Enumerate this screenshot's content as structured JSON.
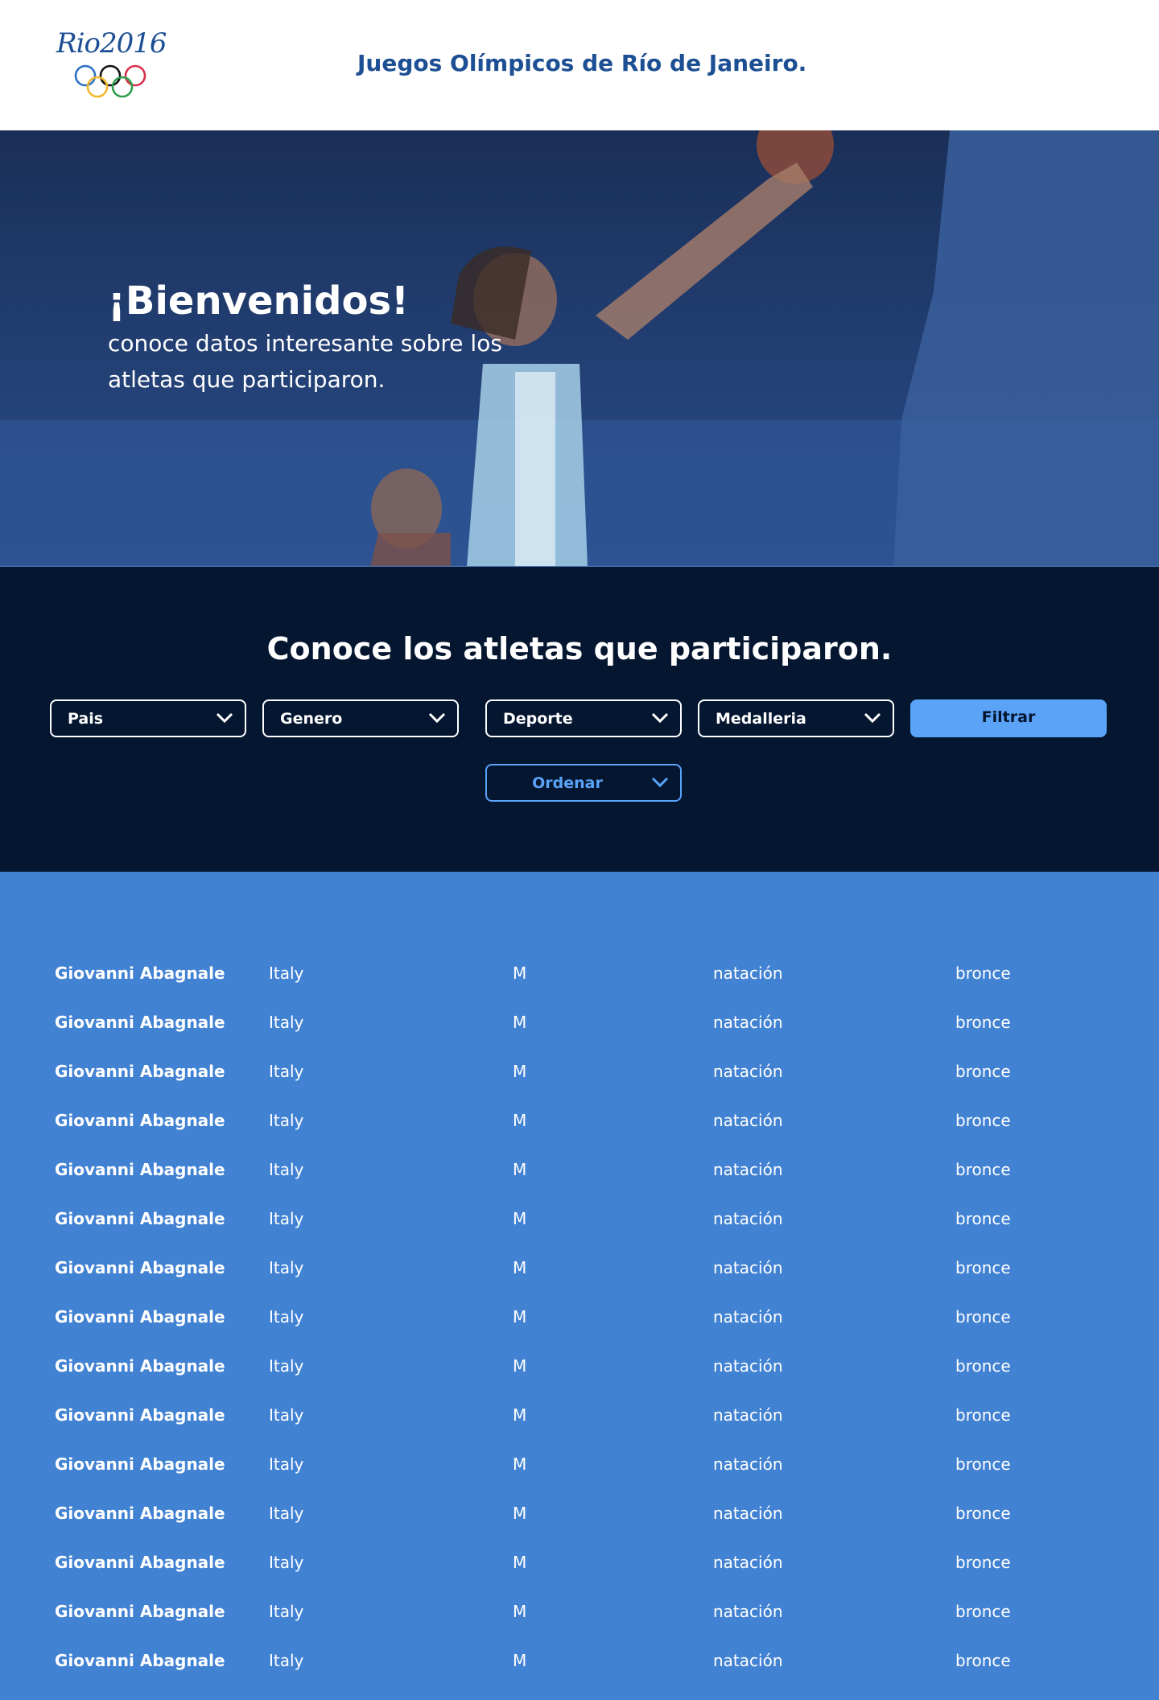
{
  "header": {
    "logo_text": "Rio2016",
    "title": "Juegos Olímpicos de Río de Janeiro."
  },
  "hero": {
    "title": "¡Bienvenidos!",
    "subtitle": "conoce datos interesante sobre los atletas que participaron."
  },
  "filters": {
    "title": "Conoce los atletas que participaron.",
    "country": "Pais",
    "gender": "Genero",
    "sport": "Deporte",
    "medals": "Medalleria",
    "filter_button": "Filtrar",
    "sort": "Ordenar"
  },
  "colors": {
    "brand_blue": "#1c4f93",
    "dark_navy": "#051630",
    "accent": "#5aa3f7",
    "table_bg": "#4282d3"
  },
  "athletes": [
    {
      "name": "Giovanni Abagnale",
      "country": "Italy",
      "gender": "M",
      "sport": "natación",
      "medal": "bronce"
    },
    {
      "name": "Giovanni Abagnale",
      "country": "Italy",
      "gender": "M",
      "sport": "natación",
      "medal": "bronce"
    },
    {
      "name": "Giovanni Abagnale",
      "country": "Italy",
      "gender": "M",
      "sport": "natación",
      "medal": "bronce"
    },
    {
      "name": "Giovanni Abagnale",
      "country": "Italy",
      "gender": "M",
      "sport": "natación",
      "medal": "bronce"
    },
    {
      "name": "Giovanni Abagnale",
      "country": "Italy",
      "gender": "M",
      "sport": "natación",
      "medal": "bronce"
    },
    {
      "name": "Giovanni Abagnale",
      "country": "Italy",
      "gender": "M",
      "sport": "natación",
      "medal": "bronce"
    },
    {
      "name": "Giovanni Abagnale",
      "country": "Italy",
      "gender": "M",
      "sport": "natación",
      "medal": "bronce"
    },
    {
      "name": "Giovanni Abagnale",
      "country": "Italy",
      "gender": "M",
      "sport": "natación",
      "medal": "bronce"
    },
    {
      "name": "Giovanni Abagnale",
      "country": "Italy",
      "gender": "M",
      "sport": "natación",
      "medal": "bronce"
    },
    {
      "name": "Giovanni Abagnale",
      "country": "Italy",
      "gender": "M",
      "sport": "natación",
      "medal": "bronce"
    },
    {
      "name": "Giovanni Abagnale",
      "country": "Italy",
      "gender": "M",
      "sport": "natación",
      "medal": "bronce"
    },
    {
      "name": "Giovanni Abagnale",
      "country": "Italy",
      "gender": "M",
      "sport": "natación",
      "medal": "bronce"
    },
    {
      "name": "Giovanni Abagnale",
      "country": "Italy",
      "gender": "M",
      "sport": "natación",
      "medal": "bronce"
    },
    {
      "name": "Giovanni Abagnale",
      "country": "Italy",
      "gender": "M",
      "sport": "natación",
      "medal": "bronce"
    },
    {
      "name": "Giovanni Abagnale",
      "country": "Italy",
      "gender": "M",
      "sport": "natación",
      "medal": "bronce"
    }
  ]
}
